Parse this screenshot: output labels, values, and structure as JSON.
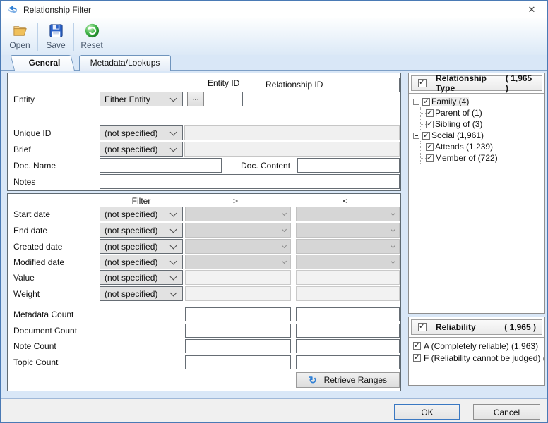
{
  "window": {
    "title": "Relationship Filter",
    "close_glyph": "✕"
  },
  "toolbar": {
    "open_label": "Open",
    "save_label": "Save",
    "reset_label": "Reset"
  },
  "tabs": {
    "general": "General",
    "metadata": "Metadata/Lookups"
  },
  "general_form": {
    "entity_id_label": "Entity ID",
    "relationship_id_label": "Relationship ID",
    "entity_label": "Entity",
    "entity_value": "Either Entity",
    "browse_label": "...",
    "unique_id_label": "Unique ID",
    "brief_label": "Brief",
    "doc_name_label": "Doc. Name",
    "doc_content_label": "Doc. Content",
    "notes_label": "Notes",
    "not_specified": "(not specified)"
  },
  "filter_section": {
    "filter_header": "Filter",
    "gte_header": ">=",
    "lte_header": "<=",
    "rows": {
      "start_date": "Start date",
      "end_date": "End date",
      "created_date": "Created date",
      "modified_date": "Modified date",
      "value": "Value",
      "weight": "Weight"
    },
    "counts": {
      "metadata": "Metadata Count",
      "document": "Document Count",
      "note": "Note Count",
      "topic": "Topic Count"
    },
    "retrieve_button": "Retrieve Ranges",
    "refresh_glyph": "↻"
  },
  "relationship_type": {
    "title": "Relationship Type",
    "count": "( 1,965 )",
    "tree": {
      "family": "Family (4)",
      "parent_of": "Parent of (1)",
      "sibling_of": "Sibling of (3)",
      "social": "Social (1,961)",
      "attends": "Attends (1,239)",
      "member_of": "Member of (722)"
    }
  },
  "reliability": {
    "title": "Reliability",
    "count": "( 1,965 )",
    "items": [
      "A (Completely reliable) (1,963)",
      "F (Reliability cannot be judged) ("
    ]
  },
  "footer": {
    "ok": "OK",
    "cancel": "Cancel"
  },
  "colors": {
    "window_border": "#4a7ab5",
    "accent_blue": "#3a78c2",
    "folder_yellow": "#f0c05a",
    "save_blue": "#2456b0",
    "reset_green": "#3fae4a",
    "refresh_blue": "#2f7fd4"
  }
}
